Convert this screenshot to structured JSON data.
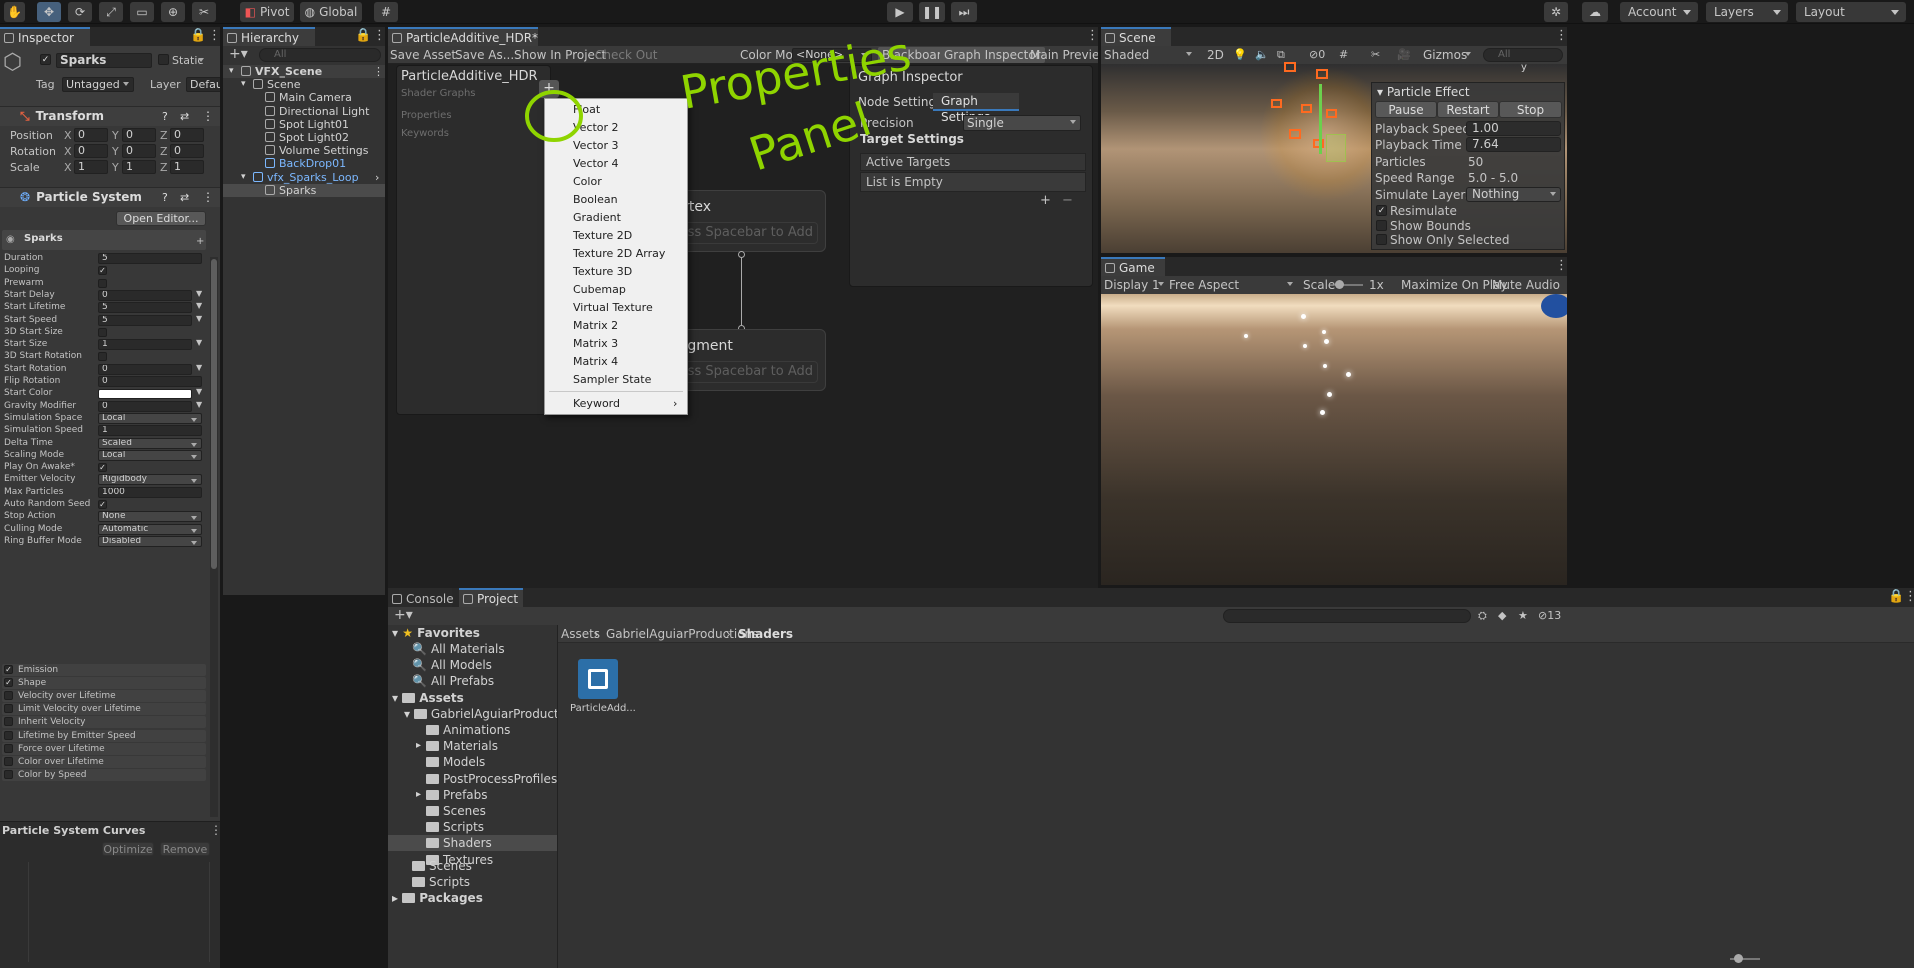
{
  "toolbar": {
    "pivot": "Pivot",
    "global": "Global",
    "account": "Account",
    "layers": "Layers",
    "layout": "Layout"
  },
  "inspector": {
    "tab": "Inspector",
    "object_name": "Sparks",
    "static_label": "Static",
    "tag_label": "Tag",
    "tag_value": "Untagged",
    "layer_label": "Layer",
    "layer_value": "Default",
    "transform": {
      "title": "Transform",
      "rows": [
        {
          "label": "Position",
          "x": "0",
          "y": "0",
          "z": "0"
        },
        {
          "label": "Rotation",
          "x": "0",
          "y": "0",
          "z": "0"
        },
        {
          "label": "Scale",
          "x": "1",
          "y": "1",
          "z": "1"
        }
      ]
    },
    "particle_system": {
      "title": "Particle System",
      "open_editor": "Open Editor...",
      "name": "Sparks",
      "props": [
        {
          "label": "Duration",
          "value": "5"
        },
        {
          "label": "Looping",
          "check": true
        },
        {
          "label": "Prewarm",
          "check": false
        },
        {
          "label": "Start Delay",
          "value": "0",
          "dd": true
        },
        {
          "label": "Start Lifetime",
          "value": "5",
          "dd": true
        },
        {
          "label": "Start Speed",
          "value": "5",
          "dd": true
        },
        {
          "label": "3D Start Size",
          "check": false
        },
        {
          "label": "Start Size",
          "value": "1",
          "dd": true
        },
        {
          "label": "3D Start Rotation",
          "check": false
        },
        {
          "label": "Start Rotation",
          "value": "0",
          "dd": true
        },
        {
          "label": "Flip Rotation",
          "value": "0"
        },
        {
          "label": "Start Color",
          "color": "#ffffff",
          "dd": true
        },
        {
          "label": "Gravity Modifier",
          "value": "0",
          "dd": true
        },
        {
          "label": "Simulation Space",
          "value": "Local",
          "sel": true
        },
        {
          "label": "Simulation Speed",
          "value": "1"
        },
        {
          "label": "Delta Time",
          "value": "Scaled",
          "sel": true
        },
        {
          "label": "Scaling Mode",
          "value": "Local",
          "sel": true
        },
        {
          "label": "Play On Awake*",
          "check": true
        },
        {
          "label": "Emitter Velocity",
          "value": "Rigidbody",
          "sel": true
        },
        {
          "label": "Max Particles",
          "value": "1000"
        },
        {
          "label": "Auto Random Seed",
          "check": true
        },
        {
          "label": "Stop Action",
          "value": "None",
          "sel": true
        },
        {
          "label": "Culling Mode",
          "value": "Automatic",
          "sel": true
        },
        {
          "label": "Ring Buffer Mode",
          "value": "Disabled",
          "sel": true
        }
      ],
      "modules": [
        {
          "label": "Emission",
          "on": true
        },
        {
          "label": "Shape",
          "on": true
        },
        {
          "label": "Velocity over Lifetime",
          "on": false
        },
        {
          "label": "Limit Velocity over Lifetime",
          "on": false
        },
        {
          "label": "Inherit Velocity",
          "on": false
        },
        {
          "label": "Lifetime by Emitter Speed",
          "on": false
        },
        {
          "label": "Force over Lifetime",
          "on": false
        },
        {
          "label": "Color over Lifetime",
          "on": false
        },
        {
          "label": "Color by Speed",
          "on": false
        }
      ]
    },
    "curves": {
      "title": "Particle System Curves",
      "optimize": "Optimize",
      "remove": "Remove"
    }
  },
  "hierarchy": {
    "tab": "Hierarchy",
    "search": "All",
    "items": [
      {
        "label": "VFX_Scene",
        "depth": 0,
        "bold": true
      },
      {
        "label": "Scene",
        "depth": 1
      },
      {
        "label": "Main Camera",
        "depth": 2
      },
      {
        "label": "Directional Light",
        "depth": 2
      },
      {
        "label": "Spot Light01",
        "depth": 2
      },
      {
        "label": "Spot Light02",
        "depth": 2
      },
      {
        "label": "Volume Settings",
        "depth": 2
      },
      {
        "label": "BackDrop01",
        "depth": 2,
        "blue": true
      },
      {
        "label": "vfx_Sparks_Loop",
        "depth": 1,
        "blue": true
      },
      {
        "label": "Sparks",
        "depth": 2,
        "selected": true
      }
    ]
  },
  "shadergraph": {
    "tab": "ParticleAdditive_HDR*",
    "save_asset": "Save Asset",
    "save_as": "Save As...",
    "show_in_project": "Show In Project",
    "check_out": "Check Out",
    "color_mode_label": "Color Mode",
    "color_mode_value": "<None>",
    "blackboard": "Blackboard",
    "graph_inspector": "Graph Inspector",
    "main_preview": "Main Preview",
    "blackboard_panel": {
      "title": "ParticleAdditive_HDR",
      "subtitle": "Shader Graphs",
      "properties": "Properties",
      "keywords": "Keywords"
    },
    "vertex_title": "Vertex",
    "fragment_title": "Fragment",
    "placeholder": "Press Spacebar to Add Node",
    "menu": {
      "items": [
        "Float",
        "Vector 2",
        "Vector 3",
        "Vector 4",
        "Color",
        "Boolean",
        "Gradient",
        "Texture 2D",
        "Texture 2D Array",
        "Texture 3D",
        "Cubemap",
        "Virtual Texture",
        "Matrix 2",
        "Matrix 3",
        "Matrix 4",
        "Sampler State"
      ],
      "keyword": "Keyword"
    },
    "inspector_panel": {
      "title": "Graph Inspector",
      "tab_node": "Node Settings",
      "tab_graph": "Graph Settings",
      "precision_label": "Precision",
      "precision_value": "Single",
      "target_settings": "Target Settings",
      "active_targets": "Active Targets",
      "list_empty": "List is Empty"
    },
    "annotation": {
      "line1": "Properties",
      "line2": "Panel",
      "color": "#8fd400"
    }
  },
  "scene": {
    "tab": "Scene",
    "shading": "Shaded",
    "mode2d": "2D",
    "gizmos": "Gizmos",
    "search": "All",
    "axis": "y",
    "effect": {
      "title": "Particle Effect",
      "pause": "Pause",
      "restart": "Restart",
      "stop": "Stop",
      "rows": [
        {
          "label": "Playback Speed",
          "value": "1.00",
          "field": true
        },
        {
          "label": "Playback Time",
          "value": "7.64",
          "field": true
        },
        {
          "label": "Particles",
          "value": "50"
        },
        {
          "label": "Speed Range",
          "value": "5.0 - 5.0"
        },
        {
          "label": "Simulate Layers",
          "value": "Nothing",
          "field": true,
          "dd": true
        }
      ],
      "checks": [
        {
          "label": "Resimulate",
          "on": true
        },
        {
          "label": "Show Bounds",
          "on": false
        },
        {
          "label": "Show Only Selected",
          "on": false
        }
      ]
    }
  },
  "game": {
    "tab": "Game",
    "display": "Display 1",
    "aspect": "Free Aspect",
    "scale_label": "Scale",
    "scale_value": "1x",
    "maximize": "Maximize On Play",
    "mute": "Mute Audio"
  },
  "project": {
    "console_tab": "Console",
    "project_tab": "Project",
    "badge": "13",
    "breadcrumb": [
      "Assets",
      "GabrielAguiarProductions",
      "Shaders"
    ],
    "favorites": {
      "title": "Favorites",
      "items": [
        "All Materials",
        "All Models",
        "All Prefabs"
      ]
    },
    "assets_title": "Assets",
    "root_child": "GabrielAguiarProductions",
    "folders": [
      {
        "label": "Animations",
        "arrow": false
      },
      {
        "label": "Materials",
        "arrow": true
      },
      {
        "label": "Models",
        "arrow": false
      },
      {
        "label": "PostProcessProfiles",
        "arrow": false
      },
      {
        "label": "Prefabs",
        "arrow": true
      },
      {
        "label": "Scenes",
        "arrow": false
      },
      {
        "label": "Scripts",
        "arrow": false
      },
      {
        "label": "Shaders",
        "arrow": false,
        "selected": true
      },
      {
        "label": "Textures",
        "arrow": false
      }
    ],
    "assets_children": [
      "Scenes",
      "Scripts"
    ],
    "packages": "Packages",
    "file": "ParticleAdd..."
  }
}
